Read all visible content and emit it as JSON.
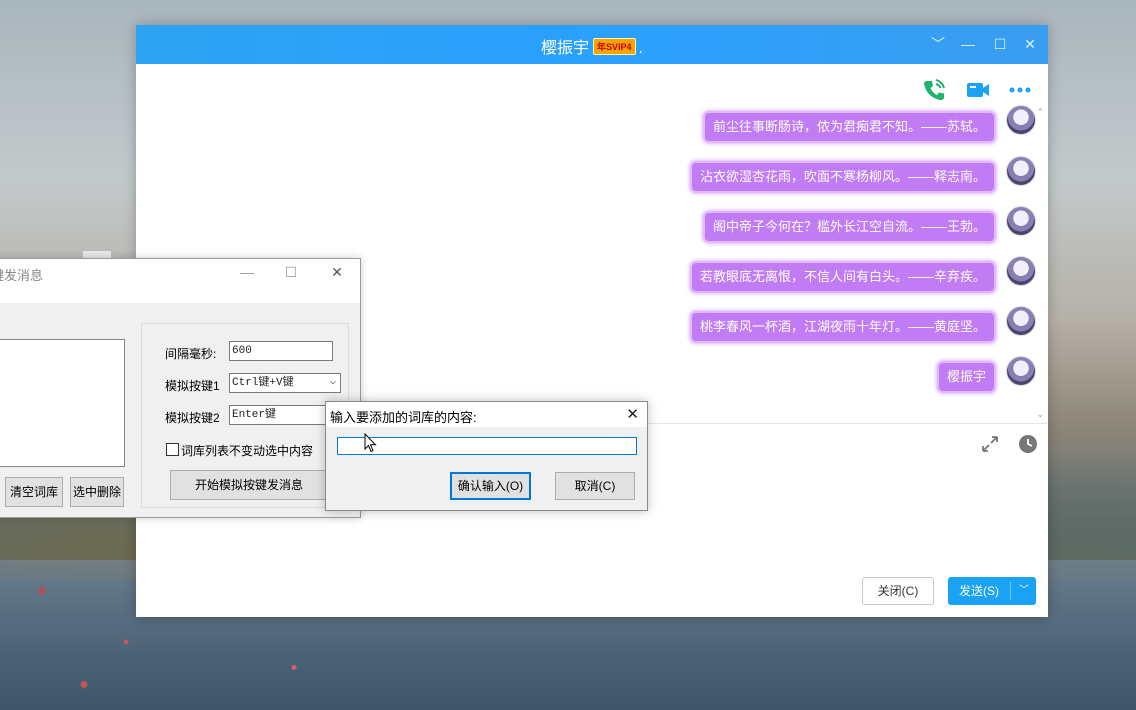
{
  "chat": {
    "title": "樱振宇",
    "vip_badge": "年SVIP4",
    "dot": ".",
    "controls": {
      "dropdown": "﹀",
      "minimize": "—",
      "maximize": "☐",
      "close": "✕"
    },
    "messages": [
      {
        "text": "前尘往事断肠诗，侬为君痴君不知。——苏轼。"
      },
      {
        "text": "沾衣欲湿杏花雨，吹面不寒杨柳风。——释志南。"
      },
      {
        "text": "阁中帝子今何在？槛外长江空自流。——王勃。"
      },
      {
        "text": "若教眼底无离恨，不信人间有白头。——辛弃疾。"
      },
      {
        "text": "桃李春风一杯酒，江湖夜雨十年灯。——黄庭坚。"
      },
      {
        "text": "樱振宇"
      }
    ],
    "close_button": "关闭(C)",
    "send_button": "发送(S)",
    "accent": "#2ea3f2",
    "bubble_color": "#c17cf5"
  },
  "tool": {
    "title": "键发消息",
    "interval_label": "间隔毫秒:",
    "interval_value": "600",
    "key1_label": "模拟按键1",
    "key1_value": "Ctrl键+V键",
    "key2_label": "模拟按键2",
    "key2_value": "Enter键",
    "checkbox_label": "词库列表不变动选中内容",
    "clear_button": "清空词库",
    "delete_button": "选中删除",
    "start_button": "开始模拟按键发消息"
  },
  "dialog": {
    "title": "输入要添加的词库的内容:",
    "input_value": "",
    "ok_button": "确认输入(O)",
    "cancel_button": "取消(C)"
  }
}
